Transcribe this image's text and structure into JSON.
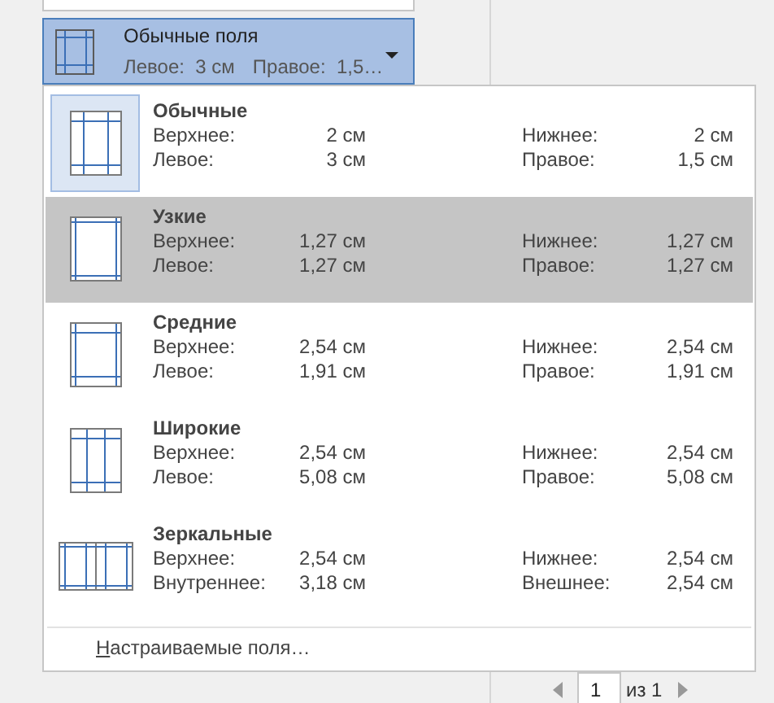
{
  "margins_button": {
    "title": "Обычные поля",
    "left": "Левое:  3 см",
    "right": "Правое:  1,5…"
  },
  "presets": [
    {
      "kind": "normal",
      "name": "Обычные",
      "selected": false,
      "current": true,
      "rows": [
        [
          "Верхнее:",
          "2 см",
          "Нижнее:",
          "2 см"
        ],
        [
          "Левое:",
          "3 см",
          "Правое:",
          "1,5 см"
        ]
      ]
    },
    {
      "kind": "narrow",
      "name": "Узкие",
      "selected": true,
      "current": false,
      "rows": [
        [
          "Верхнее:",
          "1,27 см",
          "Нижнее:",
          "1,27 см"
        ],
        [
          "Левое:",
          "1,27 см",
          "Правое:",
          "1,27 см"
        ]
      ]
    },
    {
      "kind": "moderate",
      "name": "Средние",
      "selected": false,
      "current": false,
      "rows": [
        [
          "Верхнее:",
          "2,54 см",
          "Нижнее:",
          "2,54 см"
        ],
        [
          "Левое:",
          "1,91 см",
          "Правое:",
          "1,91 см"
        ]
      ]
    },
    {
      "kind": "wide",
      "name": "Широкие",
      "selected": false,
      "current": false,
      "rows": [
        [
          "Верхнее:",
          "2,54 см",
          "Нижнее:",
          "2,54 см"
        ],
        [
          "Левое:",
          "5,08 см",
          "Правое:",
          "5,08 см"
        ]
      ]
    },
    {
      "kind": "mirrored",
      "name": "Зеркальные",
      "selected": false,
      "current": false,
      "rows": [
        [
          "Верхнее:",
          "2,54 см",
          "Нижнее:",
          "2,54 см"
        ],
        [
          "Внутреннее:",
          "3,18 см",
          "Внешнее:",
          "2,54 см"
        ]
      ]
    }
  ],
  "custom_margins": "Настраиваемые поля…",
  "pager": {
    "page": "1",
    "total": "из 1"
  }
}
